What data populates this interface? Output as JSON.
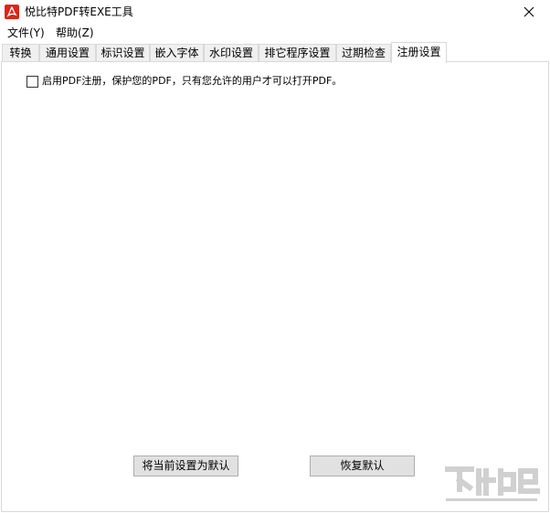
{
  "window": {
    "title": "悦比特PDF转EXE工具",
    "icon": "pdf-app-icon",
    "close_icon": "close-icon"
  },
  "menu": [
    {
      "label": "文件(Y)"
    },
    {
      "label": "帮助(Z)"
    }
  ],
  "tabs": [
    {
      "label": "转换",
      "active": false
    },
    {
      "label": "通用设置",
      "active": false
    },
    {
      "label": "标识设置",
      "active": false
    },
    {
      "label": "嵌入字体",
      "active": false
    },
    {
      "label": "水印设置",
      "active": false
    },
    {
      "label": "排它程序设置",
      "active": false
    },
    {
      "label": "过期检查",
      "active": false
    },
    {
      "label": "注册设置",
      "active": true
    }
  ],
  "registration": {
    "enable_checkbox_label": "启用PDF注册，保护您的PDF，只有您允许的用户才可以打开PDF。",
    "enable_checked": false
  },
  "buttons": {
    "save_default": "将当前设置为默认",
    "restore_default": "恢复默认"
  },
  "colors": {
    "accent_icon": "#d9261c",
    "tab_border": "#d9d9d9",
    "button_bg": "#e1e1e1"
  }
}
